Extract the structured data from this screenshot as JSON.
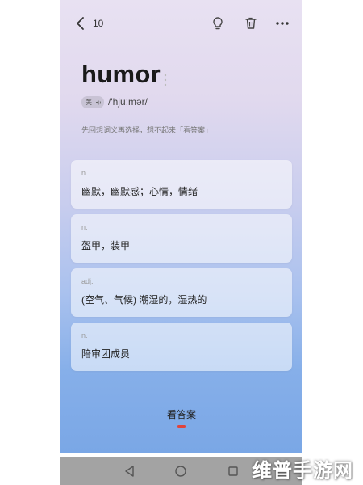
{
  "header": {
    "page_number": "10",
    "back_icon": "back-arrow-icon",
    "hint_icon": "lightbulb-icon",
    "delete_icon": "trash-icon",
    "more_icon": "more-icon"
  },
  "word": {
    "text": "humor",
    "region": "美",
    "phonetic": "/'hjuːmər/"
  },
  "hint": "先回想词义再选择，想不起来「看答案」",
  "options": [
    {
      "pos": "n.",
      "meaning": "幽默，幽默感；心情，情绪"
    },
    {
      "pos": "n.",
      "meaning": "盔甲，装甲"
    },
    {
      "pos": "adj.",
      "meaning": "(空气、气候) 潮湿的，湿热的"
    },
    {
      "pos": "n.",
      "meaning": "陪审团成员"
    }
  ],
  "answer_button": "看答案",
  "colors": {
    "accent": "#e0443c",
    "nav_bar": "#a3a3a3"
  },
  "watermark": "维普手游网"
}
